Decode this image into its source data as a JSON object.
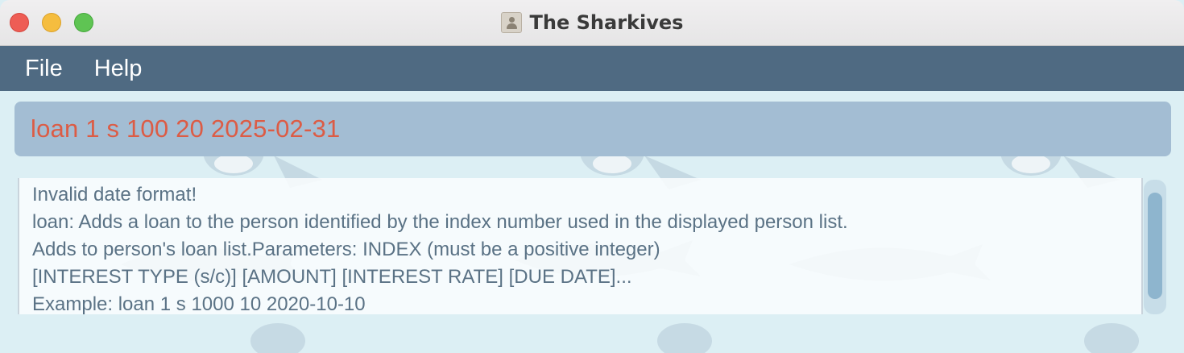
{
  "window": {
    "title": "The Sharkives"
  },
  "menu": {
    "items": [
      {
        "label": "File"
      },
      {
        "label": "Help"
      }
    ]
  },
  "command_box": {
    "value": "loan 1 s 100 20 2025-02-31",
    "text_color": "#dc5c45"
  },
  "result_display": {
    "lines": [
      "Invalid date format!",
      "loan: Adds a loan to the person identified by the index number used in the displayed person list.",
      "Adds to person's loan list.Parameters: INDEX (must be a positive integer)",
      "[INTEREST TYPE (s/c)] [AMOUNT] [INTEREST RATE] [DUE DATE]...",
      "Example: loan 1 s 1000 10 2020-10-10"
    ]
  },
  "colors": {
    "menubar": "#4f6a82",
    "command_box_bg": "#a3bdd3",
    "result_text": "#5a7285",
    "traffic_close": "#ee5d55",
    "traffic_minimize": "#f5bd3f",
    "traffic_zoom": "#5fc453"
  },
  "icons": {
    "app": "contacts-app-icon",
    "background": "shark-pattern"
  }
}
